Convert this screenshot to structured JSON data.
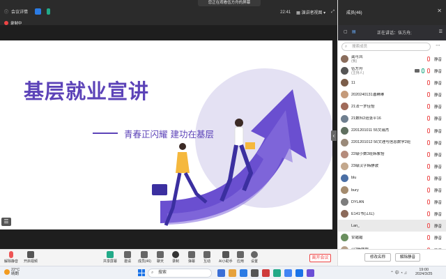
{
  "topbar": {
    "meeting_info": "会议详情",
    "share_banner": "您正在观看伍方舟的屏幕",
    "time": "22:41",
    "view_mode": "演讲者视图",
    "fullscreen_icon": "fullscreen-icon",
    "members_count": "成员(46)",
    "recording": "录制中"
  },
  "slide": {
    "title": "基层就业宣讲",
    "subtitle": "青春正闪耀  建功在基层",
    "accent": "#5c43b8"
  },
  "bottombar": {
    "mute": "解除静音",
    "video": "开启视频",
    "share": "共享屏幕",
    "manage": "邀请",
    "members": "成员(46)",
    "chat": "聊天",
    "record": "录制",
    "danmu": "弹幕",
    "interact": "互动",
    "ai": "AI小助手",
    "apps": "应用",
    "settings": "设置",
    "leave": "离开会议"
  },
  "panel": {
    "header_title": "成员(46)",
    "speaking_label": "正在讲话：伍方舟;",
    "search_placeholder": "搜索成员",
    "members": [
      {
        "name": "龚可凤",
        "role": "(我)",
        "avatar_color": "#8a6d5c",
        "status": "静音"
      },
      {
        "name": "伍方舟",
        "role": "(主持人)",
        "avatar_color": "#555555",
        "status": "静音",
        "speaking": true
      },
      {
        "name": "11",
        "role": "",
        "avatar_color": "#7b5e4a",
        "status": "静音"
      },
      {
        "name": "2020240131潘琳琳",
        "role": "",
        "avatar_color": "#c49a7a",
        "status": "静音"
      },
      {
        "name": "21法一罗佳怡",
        "role": "",
        "avatar_color": "#a06b5a",
        "status": "静音"
      },
      {
        "name": "21数科2班张平16",
        "role": "",
        "avatar_color": "#6f7f8f",
        "status": "静音"
      },
      {
        "name": "2201201011 55文瑞杰",
        "role": "",
        "avatar_color": "#5f6f5f",
        "status": "静音"
      },
      {
        "name": "2201201012 56文理与信息数学2班",
        "role": "",
        "avatar_color": "#9a8a7a",
        "status": "静音"
      },
      {
        "name": "22级小数3班韩紫怡",
        "role": "",
        "avatar_color": "#b58c7c",
        "status": "静音"
      },
      {
        "name": "23级汉字韩静波",
        "role": "",
        "avatar_color": "#c3a88d",
        "status": "静音"
      },
      {
        "name": "blu",
        "role": "",
        "avatar_color": "#4a6fa5",
        "status": "静音"
      },
      {
        "name": "bury",
        "role": "",
        "avatar_color": "#a48b6e",
        "status": "静音"
      },
      {
        "name": "DYLAN",
        "role": "",
        "avatar_color": "#7d7d7d",
        "status": "静音"
      },
      {
        "name": "E141书(江红)",
        "role": "",
        "avatar_color": "#8b6a5a",
        "status": "静音"
      },
      {
        "name": "Lan_",
        "role": "",
        "avatar_color": "#eaeaea",
        "status": "静音",
        "highlight": true
      },
      {
        "name": "甘霜霜",
        "role": "",
        "avatar_color": "#6a8f5f",
        "status": "静音"
      },
      {
        "name": "汉2杨娜娜",
        "role": "",
        "avatar_color": "#b6a08a",
        "status": "静音"
      }
    ],
    "rename_button": "修改名称",
    "unmute_button": "解除静音"
  },
  "taskbar": {
    "temp": "22°C",
    "weather": "晴朗",
    "search": "搜索",
    "time": "19:00",
    "date": "2024/3/25"
  }
}
